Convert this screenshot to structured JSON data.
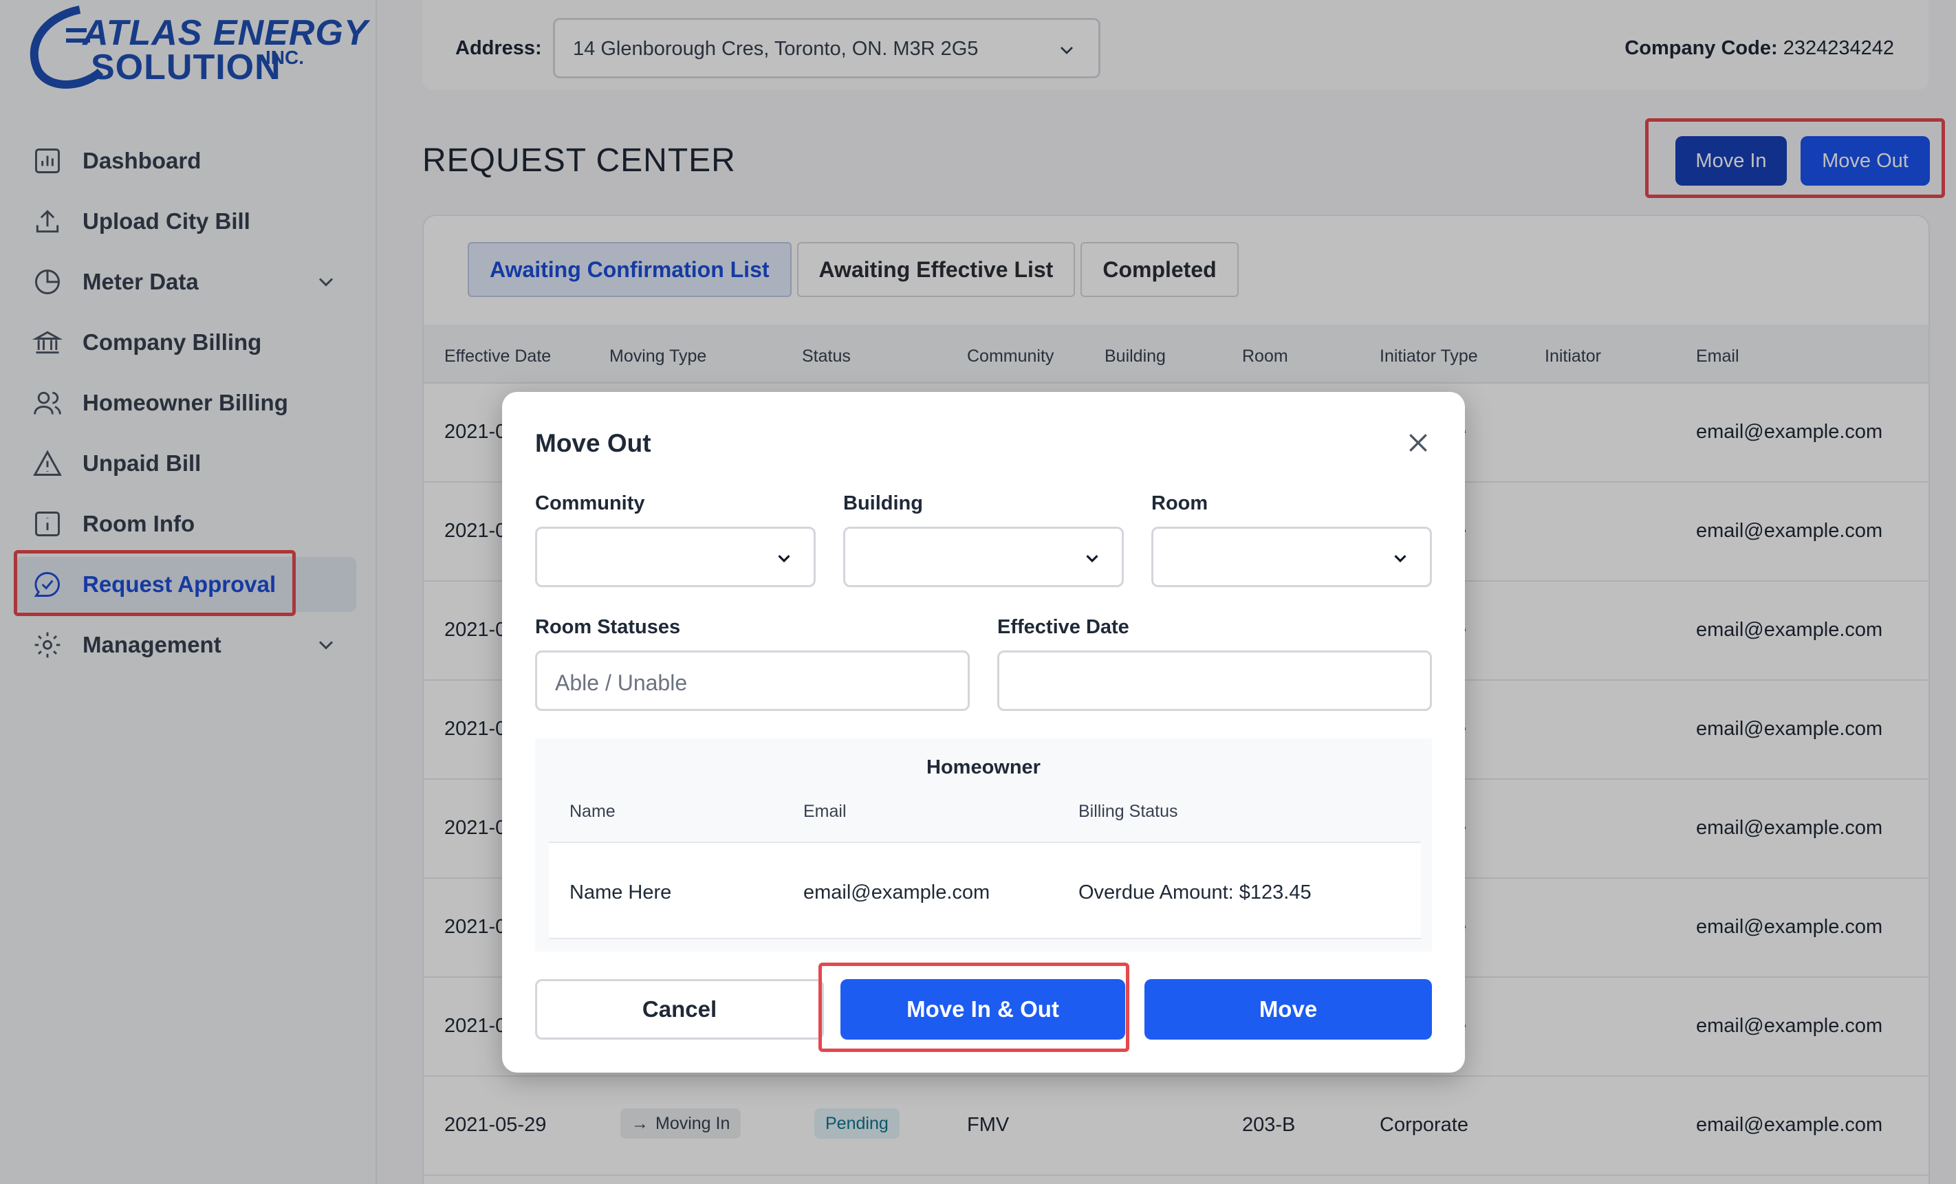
{
  "brand": {
    "line1": "ATLAS ENERGY",
    "line2": "SOLUTION",
    "suffix": "INC."
  },
  "sidebar": {
    "items": [
      {
        "label": "Dashboard",
        "icon": "chart-icon"
      },
      {
        "label": "Upload City Bill",
        "icon": "upload-icon"
      },
      {
        "label": "Meter Data",
        "icon": "pie-chart-icon"
      },
      {
        "label": "Company Billing",
        "icon": "bank-icon"
      },
      {
        "label": "Homeowner Billing",
        "icon": "users-icon"
      },
      {
        "label": "Unpaid Bill",
        "icon": "warning-icon"
      },
      {
        "label": "Room Info",
        "icon": "info-icon"
      },
      {
        "label": "Request Approval",
        "icon": "check-badge-icon",
        "active": true
      },
      {
        "label": "Management",
        "icon": "gear-icon"
      }
    ]
  },
  "topbar": {
    "address_label": "Address:",
    "address_value": "14 Glenborough Cres, Toronto, ON. M3R 2G5",
    "company_label": "Company Code:",
    "company_value": "2324234242"
  },
  "page": {
    "title": "REQUEST CENTER",
    "move_in": "Move In",
    "move_out": "Move Out"
  },
  "tabs": [
    {
      "label": "Awaiting Confirmation List",
      "active": true
    },
    {
      "label": "Awaiting Effective List"
    },
    {
      "label": "Completed"
    }
  ],
  "table": {
    "headers": [
      "Effective Date",
      "Moving Type",
      "Status",
      "Community",
      "Building",
      "Room",
      "Initiator Type",
      "Initiator",
      "Email"
    ],
    "rows": [
      {
        "date": "2021-0",
        "type_tail": "e",
        "email": "email@example.com"
      },
      {
        "date": "2021-0",
        "type_tail": "e",
        "email": "email@example.com"
      },
      {
        "date": "2021-0",
        "type_tail": "e",
        "email": "email@example.com"
      },
      {
        "date": "2021-0",
        "type_tail": "e",
        "email": "email@example.com"
      },
      {
        "date": "2021-0",
        "type_tail": "e",
        "email": "email@example.com"
      },
      {
        "date": "2021-0",
        "type_tail": "e",
        "email": "email@example.com"
      },
      {
        "date": "2021-0",
        "type_tail": "e",
        "email": "email@example.com"
      }
    ],
    "last_row": {
      "date": "2021-05-29",
      "moving_type": "Moving In",
      "status": "Pending",
      "community": "FMV",
      "room": "203-B",
      "initiator_type": "Corporate",
      "email": "email@example.com"
    }
  },
  "modal": {
    "title": "Move Out",
    "community_label": "Community",
    "building_label": "Building",
    "room_label": "Room",
    "room_statuses_label": "Room Statuses",
    "room_statuses_placeholder": "Able / Unable",
    "effective_date_label": "Effective Date",
    "homeowner": {
      "title": "Homeowner",
      "headers": [
        "Name",
        "Email",
        "Billing Status"
      ],
      "row": {
        "name": "Name Here",
        "email": "email@example.com",
        "billing": "Overdue Amount: $123.45"
      }
    },
    "cancel": "Cancel",
    "move_in_out": "Move In & Out",
    "move": "Move"
  },
  "colors": {
    "primary": "#1d5cf0",
    "primary_dark": "#1740b8",
    "highlight": "#e5484d"
  }
}
